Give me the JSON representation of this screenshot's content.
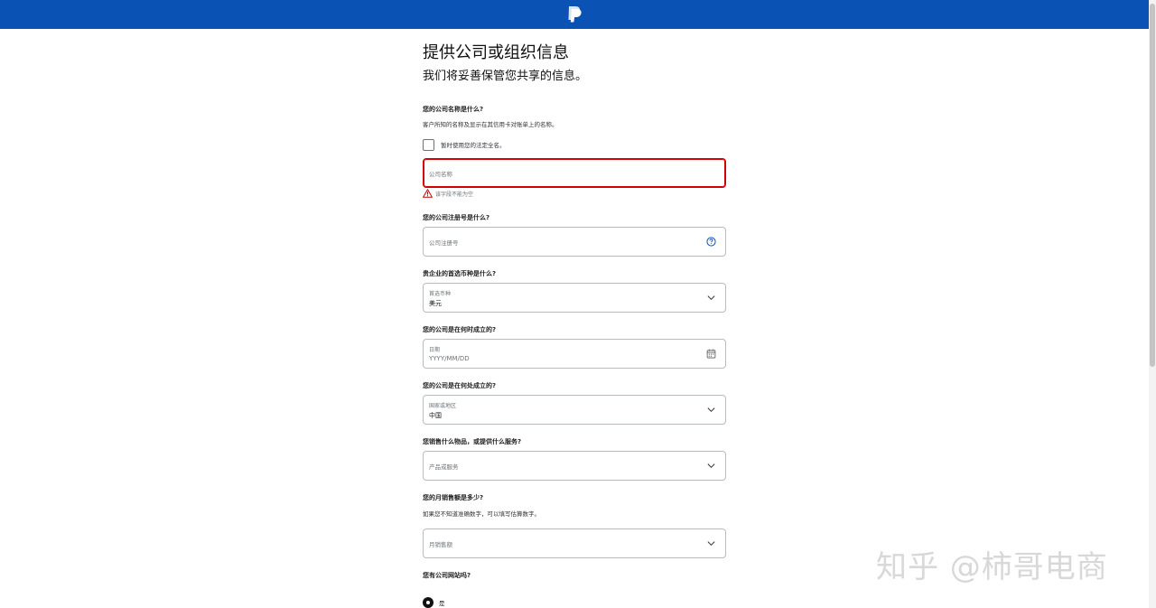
{
  "page": {
    "title": "提供公司或组织信息",
    "subtitle": "我们将妥善保管您共享的信息。"
  },
  "company_name": {
    "question": "您的公司名称是什么?",
    "hint": "客户所知的名称及显示在其信用卡对账单上的名称。",
    "checkbox_label": "暂时使用您的法定全名。",
    "placeholder": "公司名称",
    "error": "该字段不能为空"
  },
  "registration": {
    "question": "您的公司注册号是什么?",
    "placeholder": "公司注册号"
  },
  "currency": {
    "question": "贵企业的首选币种是什么?",
    "label": "首选币种",
    "value": "美元"
  },
  "founded_date": {
    "question": "您的公司是在何时成立的?",
    "label": "日期",
    "placeholder": "YYYY/MM/DD"
  },
  "founded_place": {
    "question": "您的公司是在何处成立的?",
    "label": "国家或地区",
    "value": "中国"
  },
  "products": {
    "question": "您销售什么物品，或提供什么服务?",
    "placeholder": "产品或服务"
  },
  "monthly_sales": {
    "question": "您的月销售额是多少?",
    "hint": "如果您不知道准确数字，可以填写估算数字。",
    "placeholder": "月销售额"
  },
  "website": {
    "question": "您有公司网站吗?",
    "option_yes": "是"
  },
  "watermark": "知乎 @柿哥电商",
  "colors": {
    "header": "#0a52b4",
    "error": "#d20000"
  }
}
